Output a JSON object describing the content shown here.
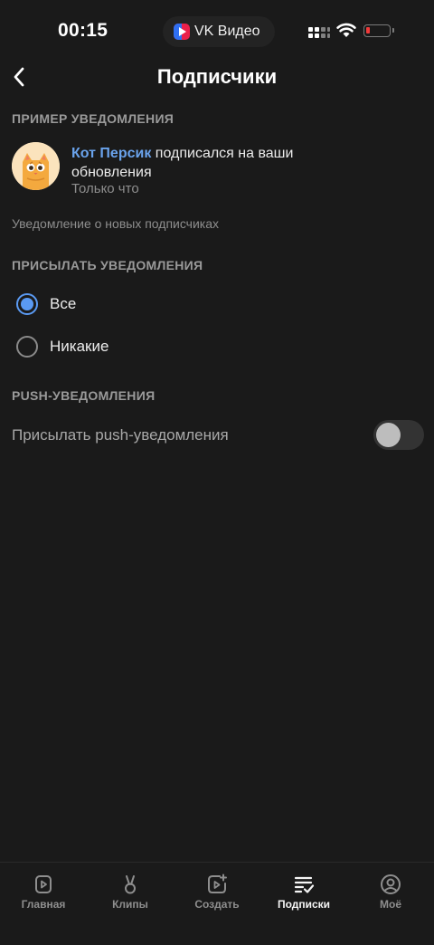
{
  "status_bar": {
    "time": "00:15",
    "app_name": "VK Видео",
    "battery_color": "#f03a3a"
  },
  "header": {
    "title": "Подписчики",
    "back_icon": "chevron-left-icon"
  },
  "example_section": {
    "header": "ПРИМЕР УВЕДОМЛЕНИЯ",
    "notification": {
      "name": "Кот Персик",
      "text": " подписался на ваши обновления",
      "time": "Только что",
      "avatar_icon": "cat-avatar-icon"
    },
    "caption": "Уведомление о новых подписчиках"
  },
  "send_section": {
    "header": "ПРИСЫЛАТЬ УВЕДОМЛЕНИЯ",
    "options": [
      {
        "label": "Все",
        "selected": true
      },
      {
        "label": "Никакие",
        "selected": false
      }
    ]
  },
  "push_section": {
    "header": "PUSH-УВЕДОМЛЕНИЯ",
    "label": "Присылать push-уведомления",
    "enabled": false
  },
  "tabbar": {
    "tabs": [
      {
        "label": "Главная",
        "icon": "home-play-icon",
        "active": false
      },
      {
        "label": "Клипы",
        "icon": "clips-icon",
        "active": false
      },
      {
        "label": "Создать",
        "icon": "create-video-icon",
        "active": false
      },
      {
        "label": "Подписки",
        "icon": "subscriptions-icon",
        "active": true
      },
      {
        "label": "Моё",
        "icon": "profile-icon",
        "active": false
      }
    ]
  },
  "colors": {
    "accent": "#5a9af3",
    "link": "#6aa3ec",
    "background": "#1a1a1a"
  }
}
